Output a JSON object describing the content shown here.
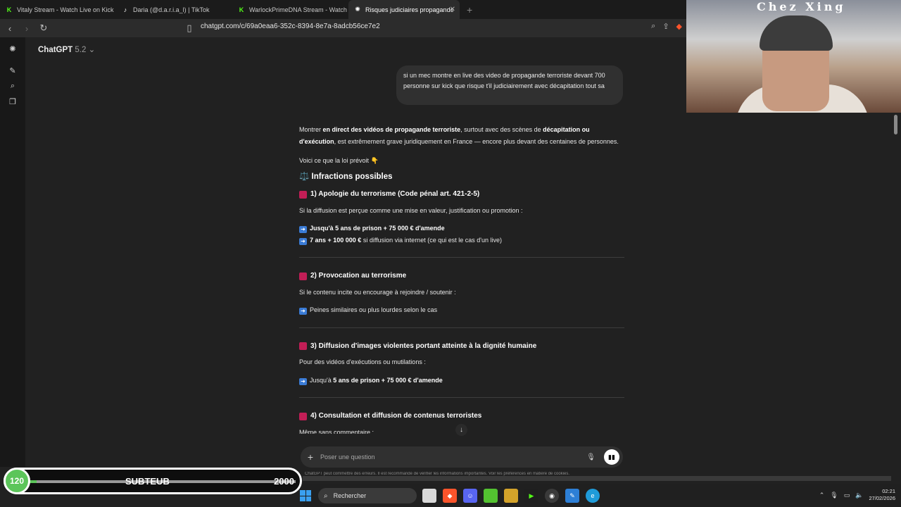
{
  "browser": {
    "tabs": [
      {
        "title": "Vitaly Stream - Watch Live on Kick",
        "icon": "kick-icon",
        "color": "#53fc18"
      },
      {
        "title": "Daria (@d.a.r.i.a_l) | TikTok",
        "icon": "tiktok-icon",
        "color": "#ffffff"
      },
      {
        "title": "WarlockPrimeDNA Stream - Watch L",
        "icon": "kick-icon",
        "color": "#53fc18"
      },
      {
        "title": "Risques judiciaires propagande",
        "icon": "chatgpt-icon",
        "color": "#ffffff"
      }
    ],
    "url": "chatgpt.com/c/69a0eaa6-352c-8394-8e7a-8adcb56ce7e2"
  },
  "app": {
    "name": "ChatGPT",
    "version": "5.2"
  },
  "webcam": {
    "sign": "Chez Xing"
  },
  "user_message": "si un mec montre en live des video de propagande terroriste devant 700 personne sur kick que risque t'il judiciairement avec décapitation tout sa",
  "response": {
    "intro_1": "Montrer ",
    "intro_b1": "en direct des vidéos de propagande terroriste",
    "intro_2": ", surtout avec des scènes de ",
    "intro_b2": "décapitation ou d'exécution",
    "intro_3": ", est extrêmement grave juridiquement en France — encore plus devant des centaines de personnes.",
    "law_intro": "Voici ce que la loi prévoit 👇",
    "section_title": "⚖️ Infractions possibles",
    "s1_title": "1) Apologie du terrorisme (Code pénal art. 421-2-5)",
    "s1_text": "Si la diffusion est perçue comme une mise en valeur, justification ou promotion :",
    "s1_b1": "Jusqu'à 5 ans de prison + 75 000 € d'amende",
    "s1_b2_bold": "7 ans + 100 000 €",
    "s1_b2_rest": " si diffusion via internet (ce qui est le cas d'un live)",
    "s2_title": "2) Provocation au terrorisme",
    "s2_text": "Si le contenu incite ou encourage à rejoindre / soutenir :",
    "s2_b1": "Peines similaires ou plus lourdes selon le cas",
    "s3_title": "3) Diffusion d'images violentes portant atteinte à la dignité humaine",
    "s3_text": "Pour des vidéos d'exécutions ou mutilations :",
    "s3_b1_pre": "Jusqu'à ",
    "s3_b1_bold": "5 ans de prison + 75 000 € d'amende",
    "s4_title": "4) Consultation et diffusion de contenus terroristes",
    "s4_text": "Même sans commentaire :"
  },
  "composer": {
    "placeholder": "Poser une question"
  },
  "disclaimer": "ChatGPT peut commettre des erreurs. Il est recommandé de vérifier les informations importantes. Voir les préférences en matière de cookies.",
  "overlay": {
    "current": "120",
    "title": "SUBTEUB",
    "goal": "2000",
    "progress": 0.06
  },
  "taskbar": {
    "search": "Rechercher",
    "time": "02:21",
    "date": "27/02/2026"
  }
}
